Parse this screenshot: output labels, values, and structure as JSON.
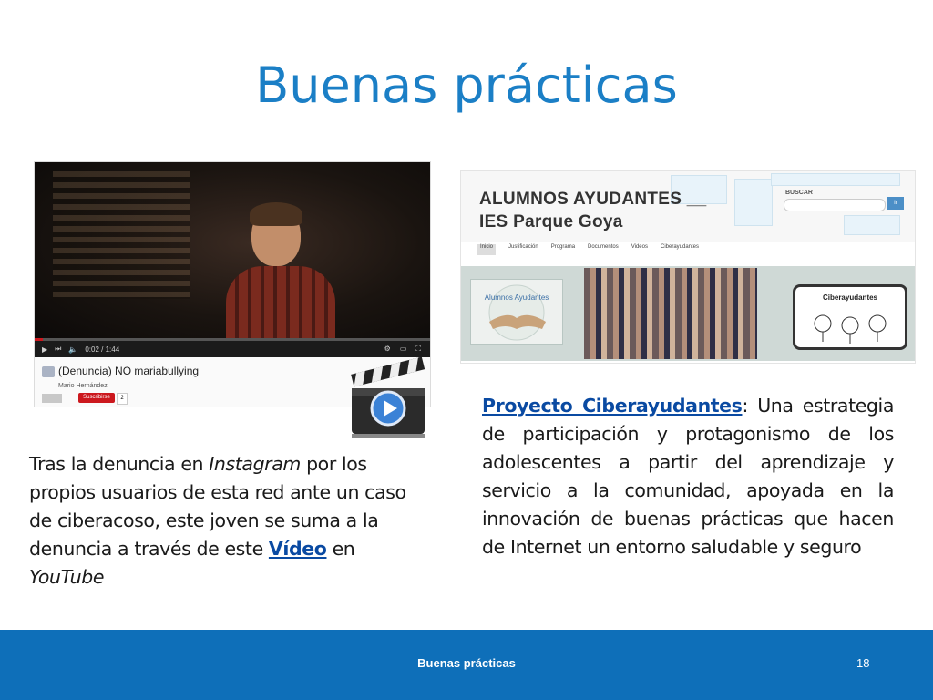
{
  "title": "Buenas prácticas",
  "youtube": {
    "video_title": "(Denuncia) NO mariabullying",
    "author": "Mario Hernández",
    "time": "0:02 / 1:44",
    "subscribe_label": "Suscribirse",
    "progress": 0.02
  },
  "website": {
    "title_line1": "ALUMNOS AYUDANTES __",
    "title_line2": "IES Parque Goya",
    "search_label": "BUSCAR",
    "search_button": "Ir",
    "nav": [
      "Inicio",
      "Justificación",
      "Programa",
      "Documentos",
      "Videos",
      "Ciberayudantes"
    ],
    "logo_text": "Alumnos Ayudantes",
    "phone_text": "Ciberayudantes"
  },
  "left_text": {
    "part1": "Tras la denuncia en ",
    "italic1": "Instagram",
    "part2": " por los propios usuarios de esta red ante un caso de ciberacoso, este joven se suma a la denuncia a través de este ",
    "link": "Vídeo",
    "part3": " en ",
    "italic2": "YouTube"
  },
  "right_text": {
    "link": "Proyecto Ciberayudantes",
    "body": ": Una estrategia de participación y protagonismo de los adolescentes a partir del aprendizaje y servicio a la comunidad, apoyada en la innovación de buenas prácticas que hacen de Internet un entorno saludable y seguro"
  },
  "footer": {
    "label": "Buenas prácticas",
    "page_number": "18"
  },
  "colors": {
    "title": "#1b7fc6",
    "footer": "#0e6fb9",
    "link": "#0a4aa2"
  }
}
